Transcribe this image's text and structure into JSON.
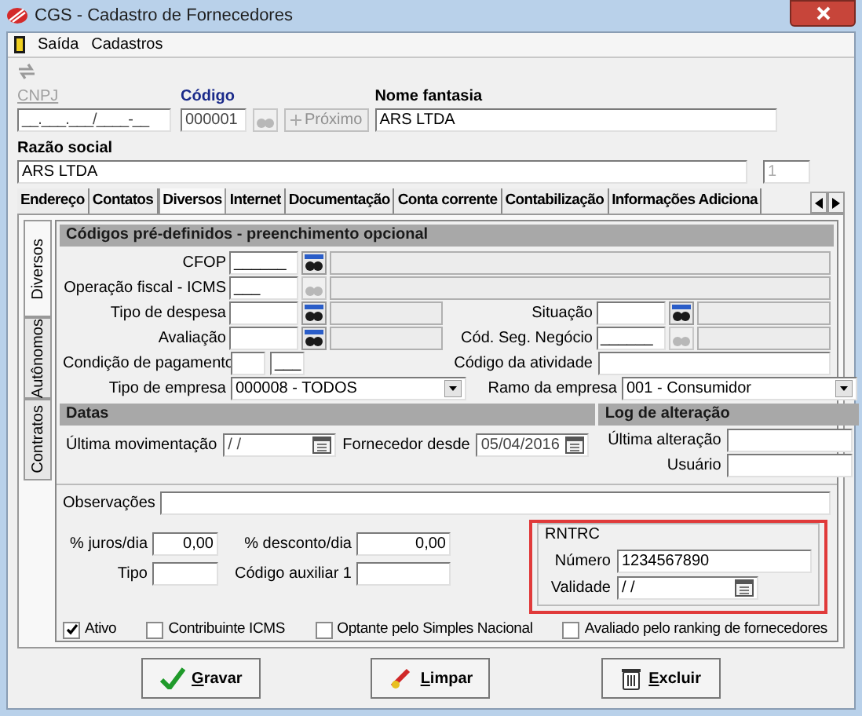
{
  "window": {
    "title": "CGS - Cadastro de Fornecedores"
  },
  "menu": [
    "Saída",
    "Cadastros"
  ],
  "header": {
    "cnpj": {
      "label": "CNPJ",
      "value": "__.___.___/____-__"
    },
    "codigo": {
      "label": "Código",
      "value": "000001"
    },
    "next_button": "Próximo",
    "nome_fantasia": {
      "label": "Nome fantasia",
      "value": "ARS LTDA"
    },
    "razao_social": {
      "label": "Razão social",
      "value": "ARS LTDA"
    },
    "side_number": "1"
  },
  "tabs": [
    {
      "label": "Endereço",
      "selected": false
    },
    {
      "label": "Contatos",
      "selected": false
    },
    {
      "label": "Diversos",
      "selected": true
    },
    {
      "label": "Internet",
      "selected": false
    },
    {
      "label": "Documentação",
      "selected": false
    },
    {
      "label": "Conta corrente",
      "selected": false
    },
    {
      "label": "Contabilização",
      "selected": false
    },
    {
      "label": "Informações Adiciona",
      "selected": false
    }
  ],
  "side_tabs": [
    {
      "label": "Diversos",
      "selected": true
    },
    {
      "label": "Autônomos",
      "selected": false
    },
    {
      "label": "Contratos",
      "selected": false
    }
  ],
  "codigos": {
    "title": "Códigos pré-definidos - preenchimento opcional",
    "rows": [
      [
        {
          "kind": "lookup",
          "label": "CFOP",
          "value": "______",
          "enabled": true
        }
      ],
      [
        {
          "kind": "lookup",
          "label": "Operação fiscal - ICMS",
          "value": "___",
          "enabled": false
        }
      ],
      [
        {
          "kind": "lookup",
          "label": "Tipo de despesa",
          "enabled": true
        },
        {
          "kind": "lookup",
          "label": "Situação",
          "enabled": true
        }
      ],
      [
        {
          "kind": "lookup",
          "label": "Avaliação",
          "enabled": true
        },
        {
          "kind": "lookup",
          "label": "Cód. Seg. Negócio",
          "value": "______",
          "enabled": false
        }
      ],
      [
        {
          "kind": "pair",
          "label": "Condição de pagamento",
          "value2": "___"
        },
        {
          "kind": "text",
          "label": "Código da atividade"
        }
      ],
      [
        {
          "kind": "select",
          "label": "Tipo de empresa",
          "value": "000008 - TODOS"
        },
        {
          "kind": "select",
          "label": "Ramo da empresa",
          "value": "001 - Consumidor"
        }
      ]
    ]
  },
  "datas": {
    "title": "Datas",
    "ultima_movimentacao": {
      "label": "Última movimentação",
      "value": "/ /"
    },
    "fornecedor_desde": {
      "label": "Fornecedor desde",
      "value": "05/04/2016"
    }
  },
  "log": {
    "title": "Log de alteração",
    "ultima_alteracao": "Última alteração",
    "usuario": "Usuário"
  },
  "observacoes": {
    "label": "Observações"
  },
  "juros": {
    "label": "% juros/dia",
    "value": "0,00"
  },
  "desconto": {
    "label": "% desconto/dia",
    "value": "0,00"
  },
  "tipo": {
    "label": "Tipo"
  },
  "codigo_auxiliar": {
    "label": "Código auxiliar 1"
  },
  "rntrc": {
    "title": "RNTRC",
    "numero": {
      "label": "Número",
      "value": "1234567890"
    },
    "validade": {
      "label": "Validade",
      "value": "/ /"
    }
  },
  "checkboxes": [
    {
      "label": "Ativo",
      "checked": true
    },
    {
      "label": "Contribuinte ICMS",
      "checked": false
    },
    {
      "label": "Optante pelo Simples Nacional",
      "checked": false
    },
    {
      "label": "Avaliado pelo ranking de fornecedores",
      "checked": false
    }
  ],
  "buttons": [
    {
      "kind": "save",
      "label": "Gravar"
    },
    {
      "kind": "clear",
      "label": "Limpar"
    },
    {
      "kind": "delete",
      "label": "Excluir"
    }
  ]
}
